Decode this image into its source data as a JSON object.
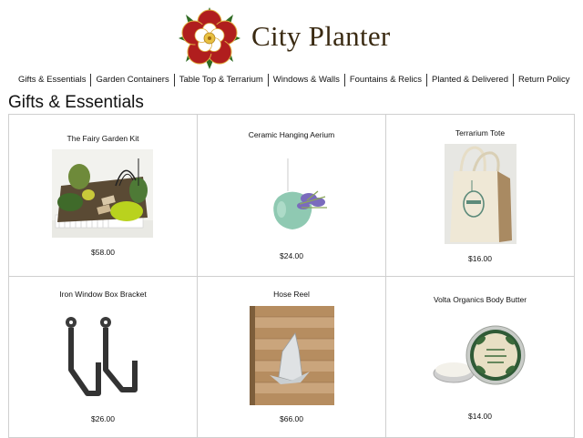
{
  "site": {
    "brand_name": "City Planter",
    "logo_icon": "tudor-rose-logo-icon"
  },
  "nav": {
    "items": [
      {
        "label": "Gifts & Essentials"
      },
      {
        "label": "Garden Containers"
      },
      {
        "label": "Table Top & Terrarium"
      },
      {
        "label": "Windows & Walls"
      },
      {
        "label": "Fountains & Relics"
      },
      {
        "label": "Planted & Delivered"
      },
      {
        "label": "Return Policy"
      }
    ]
  },
  "page": {
    "title": "Gifts & Essentials"
  },
  "products": [
    {
      "name": "The Fairy Garden Kit",
      "price": "$58.00"
    },
    {
      "name": "Ceramic Hanging Aerium",
      "price": "$24.00"
    },
    {
      "name": "Terrarium Tote",
      "price": "$16.00"
    },
    {
      "name": "Iron Window Box Bracket",
      "price": "$26.00"
    },
    {
      "name": "Hose Reel",
      "price": "$66.00"
    },
    {
      "name": "Volta Organics Body Butter",
      "price": "$14.00"
    }
  ],
  "colors": {
    "brand_text": "#3a2a12",
    "rose_red": "#b01e1e",
    "leaf_green": "#2f6b23",
    "grid_border": "#cfcfcf"
  }
}
